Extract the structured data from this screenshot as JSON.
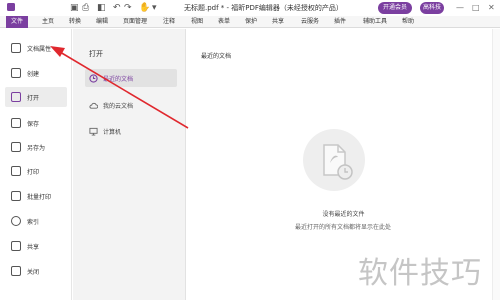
{
  "titlebar": {
    "document_title": "无标题.pdf * - 福昕PDF编辑器（未经授权的产品）",
    "btn_open_member": "开通会员",
    "btn_premium": "高科技",
    "minimize": "—",
    "maximize": "□",
    "close": "✕"
  },
  "menubar": {
    "items": [
      "文件",
      "主页",
      "转换",
      "编辑",
      "页面管理",
      "注释",
      "视图",
      "表单",
      "保护",
      "共享",
      "云服务",
      "插件",
      "辅助工具",
      "帮助"
    ]
  },
  "sidebar": {
    "items": [
      {
        "label": "文档属性"
      },
      {
        "label": "创建"
      },
      {
        "label": "打开"
      },
      {
        "label": "保存"
      },
      {
        "label": "另存为"
      },
      {
        "label": "打印"
      },
      {
        "label": "批量打印"
      },
      {
        "label": "索引"
      },
      {
        "label": "共享"
      },
      {
        "label": "关闭"
      }
    ]
  },
  "open_panel": {
    "title": "打开",
    "items": [
      {
        "label": "最近的文档"
      },
      {
        "label": "我的云文档"
      },
      {
        "label": "计算机"
      }
    ]
  },
  "main": {
    "title": "最近的文档",
    "empty_line1": "没有最近的文件",
    "empty_line2": "最近打开的所有文档都将显示在此处"
  },
  "watermark": "软件技巧",
  "colors": {
    "accent": "#7b3fa0",
    "arrow": "#e0282e"
  }
}
